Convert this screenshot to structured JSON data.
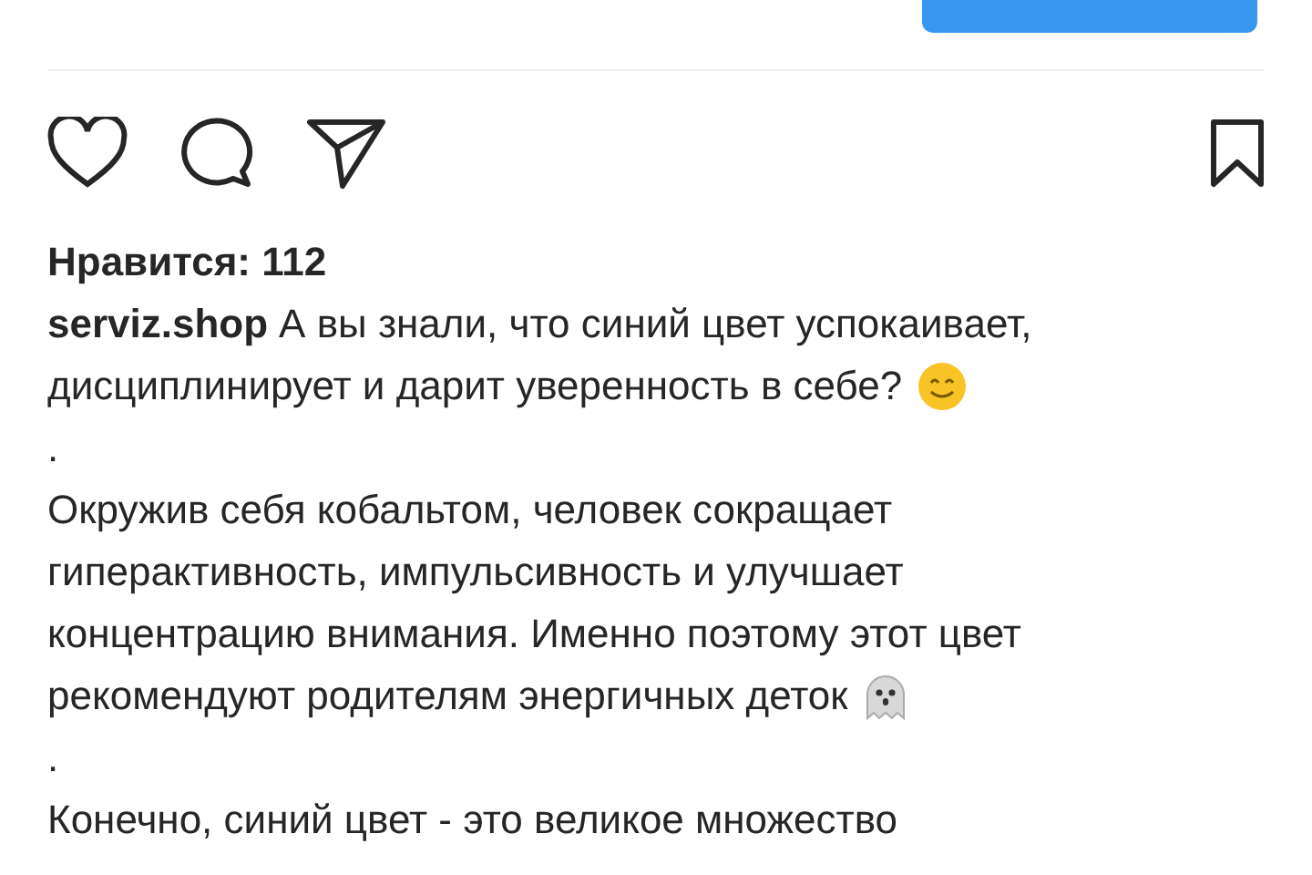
{
  "actions": {
    "liked": false,
    "saved": false
  },
  "likes": "Нравится: 112",
  "caption": {
    "username": "serviz.shop",
    "lines": [
      {
        "kind": "text",
        "text": "А вы знали,  что синий цвет успокаивает,"
      },
      {
        "kind": "smile",
        "text": "дисциплинирует и дарит уверенность в себе?"
      },
      {
        "kind": "text",
        "text": "."
      },
      {
        "kind": "text",
        "text": "Окружив себя кобальтом, человек сокращает"
      },
      {
        "kind": "text",
        "text": "гиперактивность, импульсивность и улучшает"
      },
      {
        "kind": "text",
        "text": "концентрацию внимания. Именно поэтому этот цвет"
      },
      {
        "kind": "ghost",
        "text": "рекомендуют родителям энергичных деток"
      },
      {
        "kind": "text",
        "text": "."
      },
      {
        "kind": "text",
        "text": "Конечно, синий цвет - это великое множество"
      }
    ]
  }
}
